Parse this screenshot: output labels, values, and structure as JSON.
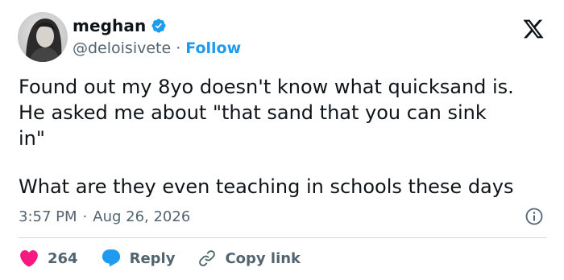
{
  "user": {
    "display_name": "meghan",
    "handle": "@deloisivete",
    "separator": "·",
    "follow_label": "Follow"
  },
  "tweet": {
    "paragraph_1": "Found out my 8yo doesn't know what quicksand is.\nHe asked me about \"that sand that you can sink\nin\"",
    "paragraph_2": "What are they even teaching in schools these days"
  },
  "meta": {
    "time": "3:57 PM",
    "separator": "·",
    "date": "Aug 26, 2026"
  },
  "actions": {
    "likes_count": "264",
    "reply_label": "Reply",
    "copy_link_label": "Copy link"
  },
  "colors": {
    "brand_blue": "#1d9bf0",
    "like_pink": "#f91880",
    "text_primary": "#0f1419",
    "text_secondary": "#536471",
    "divider": "#cfd9de"
  },
  "icons": {
    "verified": "verified-badge-icon",
    "x_logo": "x-logo-icon",
    "info": "info-icon",
    "like": "heart-icon",
    "reply": "speech-bubble-icon",
    "copy_link": "link-icon"
  }
}
